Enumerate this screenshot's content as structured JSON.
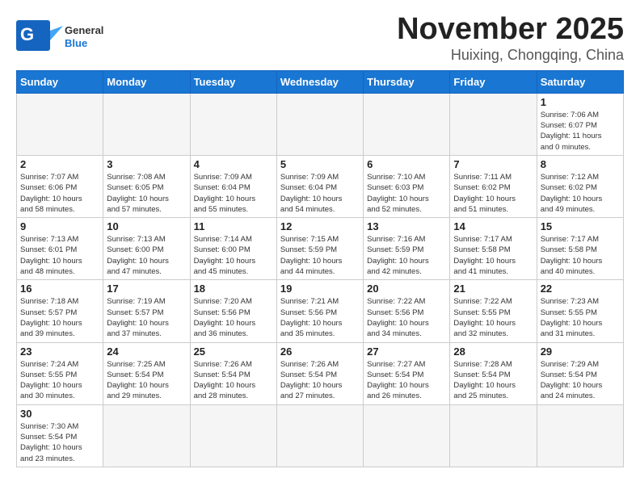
{
  "header": {
    "logo_line1": "General",
    "logo_line2": "Blue",
    "title": "November 2025",
    "subtitle": "Huixing, Chongqing, China"
  },
  "weekdays": [
    "Sunday",
    "Monday",
    "Tuesday",
    "Wednesday",
    "Thursday",
    "Friday",
    "Saturday"
  ],
  "weeks": [
    [
      {
        "day": "",
        "info": ""
      },
      {
        "day": "",
        "info": ""
      },
      {
        "day": "",
        "info": ""
      },
      {
        "day": "",
        "info": ""
      },
      {
        "day": "",
        "info": ""
      },
      {
        "day": "",
        "info": ""
      },
      {
        "day": "1",
        "info": "Sunrise: 7:06 AM\nSunset: 6:07 PM\nDaylight: 11 hours\nand 0 minutes."
      }
    ],
    [
      {
        "day": "2",
        "info": "Sunrise: 7:07 AM\nSunset: 6:06 PM\nDaylight: 10 hours\nand 58 minutes."
      },
      {
        "day": "3",
        "info": "Sunrise: 7:08 AM\nSunset: 6:05 PM\nDaylight: 10 hours\nand 57 minutes."
      },
      {
        "day": "4",
        "info": "Sunrise: 7:09 AM\nSunset: 6:04 PM\nDaylight: 10 hours\nand 55 minutes."
      },
      {
        "day": "5",
        "info": "Sunrise: 7:09 AM\nSunset: 6:04 PM\nDaylight: 10 hours\nand 54 minutes."
      },
      {
        "day": "6",
        "info": "Sunrise: 7:10 AM\nSunset: 6:03 PM\nDaylight: 10 hours\nand 52 minutes."
      },
      {
        "day": "7",
        "info": "Sunrise: 7:11 AM\nSunset: 6:02 PM\nDaylight: 10 hours\nand 51 minutes."
      },
      {
        "day": "8",
        "info": "Sunrise: 7:12 AM\nSunset: 6:02 PM\nDaylight: 10 hours\nand 49 minutes."
      }
    ],
    [
      {
        "day": "9",
        "info": "Sunrise: 7:13 AM\nSunset: 6:01 PM\nDaylight: 10 hours\nand 48 minutes."
      },
      {
        "day": "10",
        "info": "Sunrise: 7:13 AM\nSunset: 6:00 PM\nDaylight: 10 hours\nand 47 minutes."
      },
      {
        "day": "11",
        "info": "Sunrise: 7:14 AM\nSunset: 6:00 PM\nDaylight: 10 hours\nand 45 minutes."
      },
      {
        "day": "12",
        "info": "Sunrise: 7:15 AM\nSunset: 5:59 PM\nDaylight: 10 hours\nand 44 minutes."
      },
      {
        "day": "13",
        "info": "Sunrise: 7:16 AM\nSunset: 5:59 PM\nDaylight: 10 hours\nand 42 minutes."
      },
      {
        "day": "14",
        "info": "Sunrise: 7:17 AM\nSunset: 5:58 PM\nDaylight: 10 hours\nand 41 minutes."
      },
      {
        "day": "15",
        "info": "Sunrise: 7:17 AM\nSunset: 5:58 PM\nDaylight: 10 hours\nand 40 minutes."
      }
    ],
    [
      {
        "day": "16",
        "info": "Sunrise: 7:18 AM\nSunset: 5:57 PM\nDaylight: 10 hours\nand 39 minutes."
      },
      {
        "day": "17",
        "info": "Sunrise: 7:19 AM\nSunset: 5:57 PM\nDaylight: 10 hours\nand 37 minutes."
      },
      {
        "day": "18",
        "info": "Sunrise: 7:20 AM\nSunset: 5:56 PM\nDaylight: 10 hours\nand 36 minutes."
      },
      {
        "day": "19",
        "info": "Sunrise: 7:21 AM\nSunset: 5:56 PM\nDaylight: 10 hours\nand 35 minutes."
      },
      {
        "day": "20",
        "info": "Sunrise: 7:22 AM\nSunset: 5:56 PM\nDaylight: 10 hours\nand 34 minutes."
      },
      {
        "day": "21",
        "info": "Sunrise: 7:22 AM\nSunset: 5:55 PM\nDaylight: 10 hours\nand 32 minutes."
      },
      {
        "day": "22",
        "info": "Sunrise: 7:23 AM\nSunset: 5:55 PM\nDaylight: 10 hours\nand 31 minutes."
      }
    ],
    [
      {
        "day": "23",
        "info": "Sunrise: 7:24 AM\nSunset: 5:55 PM\nDaylight: 10 hours\nand 30 minutes."
      },
      {
        "day": "24",
        "info": "Sunrise: 7:25 AM\nSunset: 5:54 PM\nDaylight: 10 hours\nand 29 minutes."
      },
      {
        "day": "25",
        "info": "Sunrise: 7:26 AM\nSunset: 5:54 PM\nDaylight: 10 hours\nand 28 minutes."
      },
      {
        "day": "26",
        "info": "Sunrise: 7:26 AM\nSunset: 5:54 PM\nDaylight: 10 hours\nand 27 minutes."
      },
      {
        "day": "27",
        "info": "Sunrise: 7:27 AM\nSunset: 5:54 PM\nDaylight: 10 hours\nand 26 minutes."
      },
      {
        "day": "28",
        "info": "Sunrise: 7:28 AM\nSunset: 5:54 PM\nDaylight: 10 hours\nand 25 minutes."
      },
      {
        "day": "29",
        "info": "Sunrise: 7:29 AM\nSunset: 5:54 PM\nDaylight: 10 hours\nand 24 minutes."
      }
    ],
    [
      {
        "day": "30",
        "info": "Sunrise: 7:30 AM\nSunset: 5:54 PM\nDaylight: 10 hours\nand 23 minutes."
      },
      {
        "day": "",
        "info": ""
      },
      {
        "day": "",
        "info": ""
      },
      {
        "day": "",
        "info": ""
      },
      {
        "day": "",
        "info": ""
      },
      {
        "day": "",
        "info": ""
      },
      {
        "day": "",
        "info": ""
      }
    ]
  ]
}
